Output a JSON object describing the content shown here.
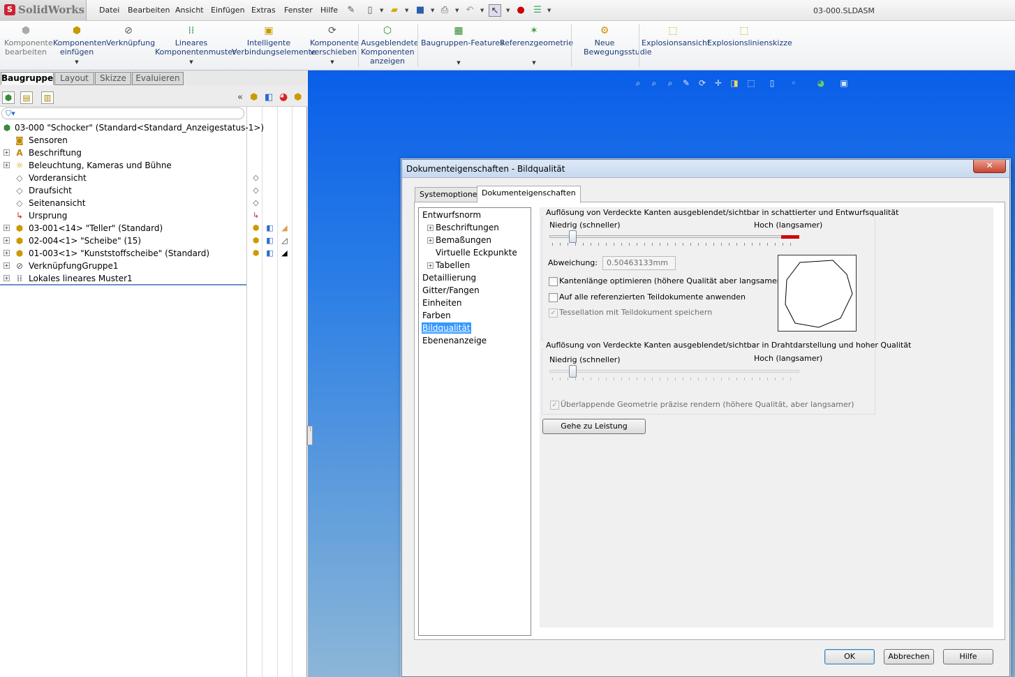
{
  "app": {
    "logo_text": "SolidWorks",
    "filename": "03-000.SLDASM"
  },
  "menu": [
    "Datei",
    "Bearbeiten",
    "Ansicht",
    "Einfügen",
    "Extras",
    "Fenster",
    "Hilfe"
  ],
  "ribbon": {
    "items": [
      {
        "label": "Komponente bearbeiten",
        "icon": "edit-component-icon"
      },
      {
        "label": "Komponenten einfügen",
        "icon": "insert-components-icon"
      },
      {
        "label": "Verknüpfung",
        "icon": "mate-icon"
      },
      {
        "label": "Lineares Komponentenmuster",
        "icon": "linear-pattern-icon"
      },
      {
        "label": "Intelligente Verbindungselemente",
        "icon": "smart-fasteners-icon"
      },
      {
        "label": "Komponente verschieben",
        "icon": "move-component-icon"
      },
      {
        "label": "Ausgeblendete Komponenten anzeigen",
        "icon": "show-hidden-icon"
      },
      {
        "label": "Baugruppen-Features",
        "icon": "assembly-features-icon"
      },
      {
        "label": "Referenzgeometrie",
        "icon": "reference-geometry-icon"
      },
      {
        "label": "Neue Bewegungsstudie",
        "icon": "motion-study-icon"
      },
      {
        "label": "Explosionsansicht",
        "icon": "exploded-view-icon"
      },
      {
        "label": "Explosionslinienskizze",
        "icon": "explode-line-sketch-icon"
      }
    ]
  },
  "command_tabs": [
    "Baugruppe",
    "Layout",
    "Skizze",
    "Evaluieren"
  ],
  "feature_tree": {
    "root": "03-000 \"Schocker\"  (Standard<Standard_Anzeigestatus-1>)",
    "items": [
      "Sensoren",
      "Beschriftung",
      "Beleuchtung, Kameras und Bühne",
      "Vorderansicht",
      "Draufsicht",
      "Seitenansicht",
      "Ursprung",
      "03-001<14> \"Teller\" (Standard)",
      "02-004<1> \"Scheibe\" (15)",
      "01-003<1> \"Kunststoffscheibe\" (Standard)",
      "VerknüpfungGruppe1",
      "Lokales lineares Muster1"
    ]
  },
  "dialog": {
    "title": "Dokumenteigenschaften - Bildqualität",
    "close_label": "✕",
    "tabs": [
      "Systemoptionen",
      "Dokumenteigenschaften"
    ],
    "nav": [
      "Entwurfsnorm",
      "Beschriftungen",
      "Bemaßungen",
      "Virtuelle Eckpunkte",
      "Tabellen",
      "Detaillierung",
      "Gitter/Fangen",
      "Einheiten",
      "Farben",
      "Bildqualität",
      "Ebenenanzeige"
    ],
    "shaded": {
      "title": "Auflösung von Verdeckte Kanten ausgeblendet/sichtbar in schattierter und Entwurfsqualität",
      "low_label": "Niedrig (schneller)",
      "high_label": "Hoch (langsamer)",
      "slider_level": 0.08,
      "deviation_label": "Abweichung:",
      "deviation_value": "0.50463133mm",
      "opt_edge_length": "Kantenlänge optimieren (höhere Qualität aber langsamer)",
      "apply_all": "Auf alle referenzierten Teildokumente anwenden",
      "save_tessellation": "Tessellation mit Teildokument speichern"
    },
    "wireframe": {
      "title": "Auflösung von Verdeckte Kanten ausgeblendet/sichtbar in Drahtdarstellung und hoher Qualität",
      "low_label": "Niedrig (schneller)",
      "high_label": "Hoch (langsamer)",
      "slider_level": 0.08,
      "overlap": "Überlappende Geometrie präzise rendern (höhere Qualität, aber langsamer)"
    },
    "goto_performance": "Gehe zu Leistung",
    "ok": "OK",
    "cancel": "Abbrechen",
    "help": "Hilfe"
  }
}
